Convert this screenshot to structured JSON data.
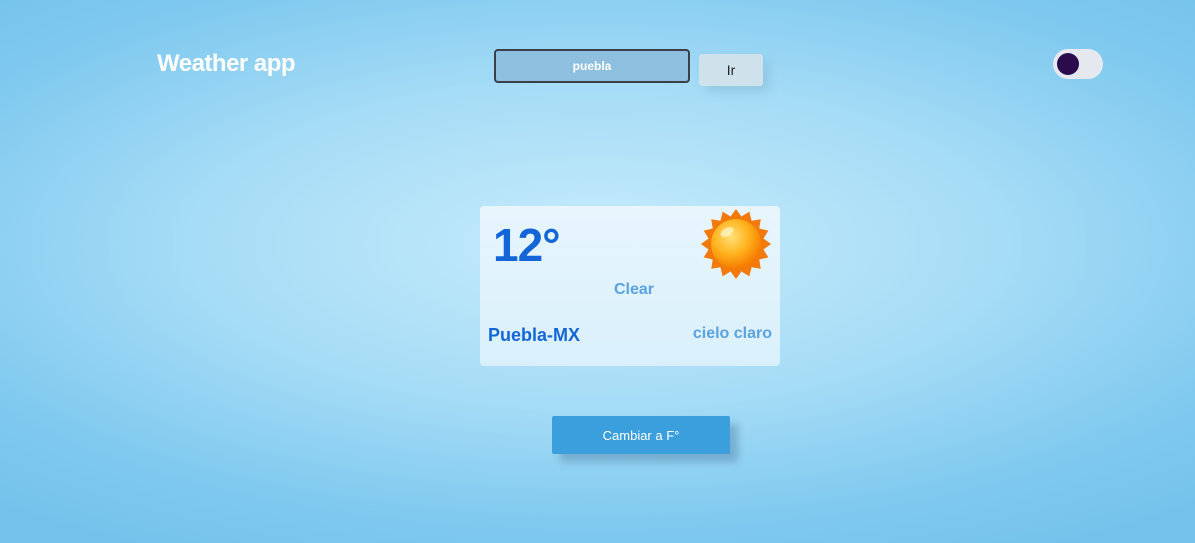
{
  "header": {
    "title": "Weather app",
    "search": {
      "value": "puebla",
      "placeholder": ""
    },
    "go_label": "Ir",
    "theme_toggle": {
      "state": "dark",
      "knob_color": "#2a0c4c"
    }
  },
  "weather": {
    "temperature": "12°",
    "icon": "sun-icon",
    "main": "Clear",
    "city": "Puebla-MX",
    "description": "cielo claro"
  },
  "unit_button_label": "Cambiar a F°",
  "colors": {
    "accent": "#1466d8",
    "secondary_text": "#5aa2e0",
    "button": "#3a9fdc"
  }
}
